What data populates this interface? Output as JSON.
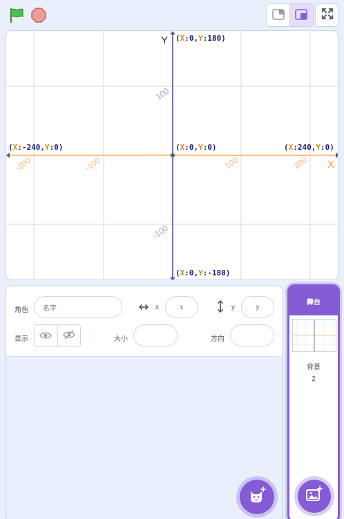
{
  "toolbar": {
    "green_flag_icon": "green-flag-icon",
    "stop_icon": "stop-icon",
    "small_stage_icon": "small-stage-icon",
    "large_stage_icon": "large-stage-icon",
    "fullscreen_icon": "fullscreen-icon"
  },
  "stage": {
    "y_axis_label": "Y",
    "x_axis_label": "X",
    "top": {
      "xk": "X",
      "xv": ":0",
      "sep": ",",
      "yk": "Y",
      "yv": ":180"
    },
    "bottom": {
      "xk": "X",
      "xv": ":0",
      "sep": ",",
      "yk": "Y",
      "yv": ":-180"
    },
    "left": {
      "xk": "X",
      "xv": ":-240",
      "sep": ",",
      "yk": "Y",
      "yv": ":0"
    },
    "right": {
      "xk": "X",
      "xv": ":240",
      "sep": ",",
      "yk": "Y",
      "yv": ":0"
    },
    "center": {
      "xk": "X",
      "xv": ":0",
      "sep": ",",
      "yk": "Y",
      "yv": ":0"
    },
    "tick_y_pos": "100",
    "tick_y_neg": "-100",
    "tick_x_200": "200",
    "tick_x_100": "100",
    "tick_x_neg100": "-100",
    "tick_x_neg200": "-200",
    "colors": {
      "x_axis": "#f39c33",
      "y_axis": "#1c1c6e",
      "grid": "#d9d9d9",
      "accent": "#855cd6"
    }
  },
  "sprite_info": {
    "sprite_label": "角色",
    "name_placeholder": "名字",
    "x_label": "x",
    "x_placeholder": "x",
    "y_label": "y",
    "y_placeholder": "y",
    "show_label": "显示",
    "size_label": "大小",
    "direction_label": "方向",
    "show_icon": "eye-icon",
    "hide_icon": "eye-slash-icon",
    "add_sprite_icon": "cat-plus-icon"
  },
  "stage_selector": {
    "header": "舞台",
    "backdrops_label": "背景",
    "backdrops_count": "2",
    "add_backdrop_icon": "image-plus-icon"
  }
}
